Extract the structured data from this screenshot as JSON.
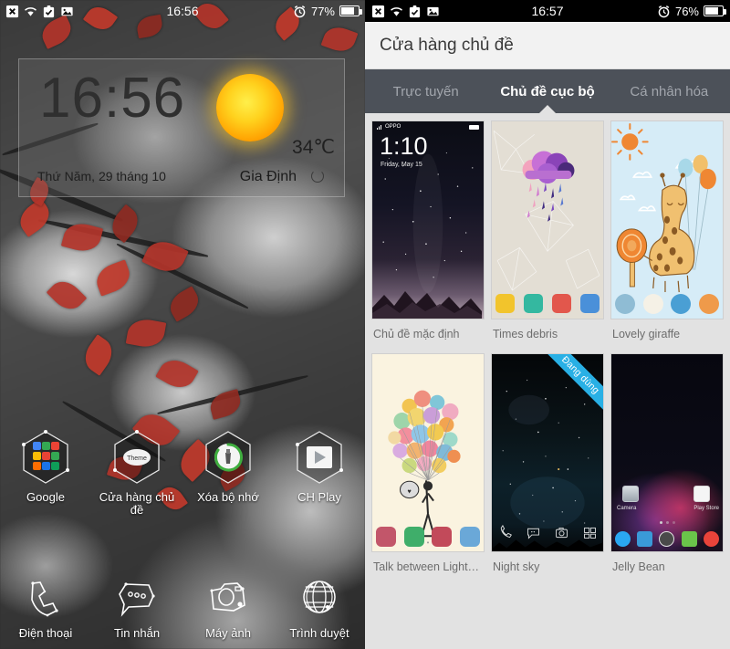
{
  "left_phone": {
    "statusbar": {
      "icons": [
        "no-sim-icon",
        "wifi-icon",
        "task-check-icon",
        "screenshot-icon"
      ],
      "time": "16:56",
      "alarm_icon": "alarm-clock-icon",
      "battery_percent": "77%"
    },
    "clock_widget": {
      "time": "16:56",
      "date": "Thứ Năm, 29 tháng 10",
      "temperature": "34℃",
      "city": "Gia Định",
      "weather_icon": "sun-icon",
      "refresh_icon": "refresh-icon"
    },
    "apps": [
      {
        "label": "Google",
        "icon": "google-folder-icon"
      },
      {
        "label": "Cửa hàng chủ đề",
        "icon": "theme-store-icon"
      },
      {
        "label": "Xóa bộ nhớ",
        "icon": "clean-memory-icon"
      },
      {
        "label": "CH Play",
        "icon": "play-store-icon"
      }
    ],
    "dock": [
      {
        "label": "Điện thoại",
        "icon": "phone-icon"
      },
      {
        "label": "Tin nhắn",
        "icon": "message-icon"
      },
      {
        "label": "Máy ảnh",
        "icon": "camera-icon"
      },
      {
        "label": "Trình duyệt",
        "icon": "browser-globe-icon"
      }
    ]
  },
  "right_phone": {
    "statusbar": {
      "icons": [
        "no-sim-icon",
        "wifi-icon",
        "task-check-icon",
        "screenshot-icon"
      ],
      "time": "16:57",
      "alarm_icon": "alarm-clock-icon",
      "battery_percent": "76%"
    },
    "header": {
      "title": "Cửa hàng chủ đề"
    },
    "tabs": [
      {
        "label": "Trực tuyến",
        "active": false
      },
      {
        "label": "Chủ đề cục bộ",
        "active": true
      },
      {
        "label": "Cá nhân hóa",
        "active": false
      }
    ],
    "themes": [
      {
        "label": "Chủ đề mặc định",
        "preview": "starry-mountain-lockscreen",
        "badge": "",
        "preview_text": {
          "carrier": "OPPO",
          "time": "1:10",
          "date": "Friday, May 15"
        }
      },
      {
        "label": "Times debris",
        "preview": "watercolor-rain-cloud",
        "badge": ""
      },
      {
        "label": "Lovely giraffe",
        "preview": "giraffe-balloons",
        "badge": ""
      },
      {
        "label": "Talk between Light…",
        "preview": "balloon-bouquet",
        "badge": ""
      },
      {
        "label": "Night sky",
        "preview": "starry-night-sky",
        "badge": "Đang dùng"
      },
      {
        "label": "Jelly Bean",
        "preview": "android-jellybean-home",
        "badge": "",
        "preview_text": {
          "camera": "Camera",
          "play": "Play Store"
        }
      }
    ],
    "colors": {
      "tabbar_bg": "#4c5159",
      "page_bg": "#e2e2e2",
      "header_bg": "#f2f2f2",
      "badge_bg": "#29b0e5",
      "label_text": "#6d6d6d"
    }
  }
}
